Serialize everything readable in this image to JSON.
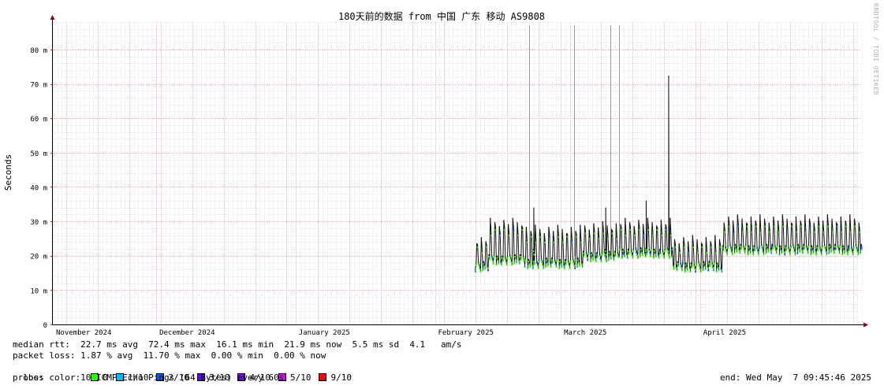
{
  "colors": {
    "grid_minor": "#e6e6e6",
    "grid_major": "#f0b0b0",
    "median": "#1a2e8c",
    "smoke": "#222222",
    "axis": "#000000",
    "arrow": "#8b0000"
  },
  "watermark": "RRDTOOL / TOBI OETIKER",
  "chart_data": {
    "type": "line",
    "title": "180天前的数据 from 中国 广东 移动 AS9808",
    "ylabel": "Seconds",
    "ylim": [
      0,
      0.088
    ],
    "yticks": [
      {
        "v": 0,
        "label": "0"
      },
      {
        "v": 0.01,
        "label": "10 m"
      },
      {
        "v": 0.02,
        "label": "20 m"
      },
      {
        "v": 0.03,
        "label": "30 m"
      },
      {
        "v": 0.04,
        "label": "40 m"
      },
      {
        "v": 0.05,
        "label": "50 m"
      },
      {
        "v": 0.06,
        "label": "60 m"
      },
      {
        "v": 0.07,
        "label": "70 m"
      },
      {
        "v": 0.08,
        "label": "80 m"
      }
    ],
    "xlim": [
      "2024-11-08",
      "2025-05-07"
    ],
    "xticks": [
      {
        "date": "2024-11-01",
        "label": "November 2024"
      },
      {
        "date": "2024-12-01",
        "label": "December 2024"
      },
      {
        "date": "2025-01-01",
        "label": "January 2025"
      },
      {
        "date": "2025-02-01",
        "label": "February 2025"
      },
      {
        "date": "2025-03-01",
        "label": "March 2025"
      },
      {
        "date": "2025-04-01",
        "label": "April 2025"
      }
    ],
    "data_start": "2025-02-10",
    "series": [
      {
        "name": "median rtt",
        "segments": [
          {
            "from": "2025-02-10",
            "to": "2025-02-13",
            "low": 0.016,
            "high": 0.026
          },
          {
            "from": "2025-02-13",
            "to": "2025-02-21",
            "low": 0.018,
            "high": 0.031
          },
          {
            "from": "2025-02-21",
            "to": "2025-03-06",
            "low": 0.017,
            "high": 0.029
          },
          {
            "from": "2025-03-06",
            "to": "2025-03-14",
            "low": 0.019,
            "high": 0.03
          },
          {
            "from": "2025-03-14",
            "to": "2025-03-26",
            "low": 0.02,
            "high": 0.031
          },
          {
            "from": "2025-03-26",
            "to": "2025-04-06",
            "low": 0.016,
            "high": 0.026
          },
          {
            "from": "2025-04-06",
            "to": "2025-05-07",
            "low": 0.021,
            "high": 0.032
          }
        ],
        "spikes": [
          {
            "date": "2025-03-25",
            "value": 0.0724
          },
          {
            "date": "2025-03-20",
            "value": 0.036
          },
          {
            "date": "2025-02-23",
            "value": 0.034
          },
          {
            "date": "2025-03-11",
            "value": 0.034
          }
        ],
        "outliers": [
          {
            "date": "2025-02-22",
            "value": 0.087
          },
          {
            "date": "2025-03-04",
            "value": 0.087
          },
          {
            "date": "2025-03-12",
            "value": 0.087
          },
          {
            "date": "2025-03-14",
            "value": 0.087
          }
        ]
      }
    ]
  },
  "legend": {
    "median_line": "median rtt:  22.7 ms avg  72.4 ms max  16.1 ms min  21.9 ms now  5.5 ms sd  4.1   am/s",
    "loss_line": "packet loss: 1.87 % avg  11.70 % max  0.00 % min  0.00 % now",
    "loss_color_label": "loss color:  ",
    "loss_colors": [
      {
        "label": "0",
        "color": "#26ff00"
      },
      {
        "label": "1/10",
        "color": "#00b8ff"
      },
      {
        "label": "2/10",
        "color": "#0059ff"
      },
      {
        "label": "3/10",
        "color": "#5e00ff"
      },
      {
        "label": "4/10",
        "color": "#7e00ff"
      },
      {
        "label": "5/10",
        "color": "#dd00ff"
      },
      {
        "label": "9/10",
        "color": "#ff0000"
      }
    ],
    "probe_line": "probe:       10 ICMP Echo Pings (64 Bytes) every 60s",
    "end_text": "end: Wed May  7 09:45:46 2025"
  }
}
